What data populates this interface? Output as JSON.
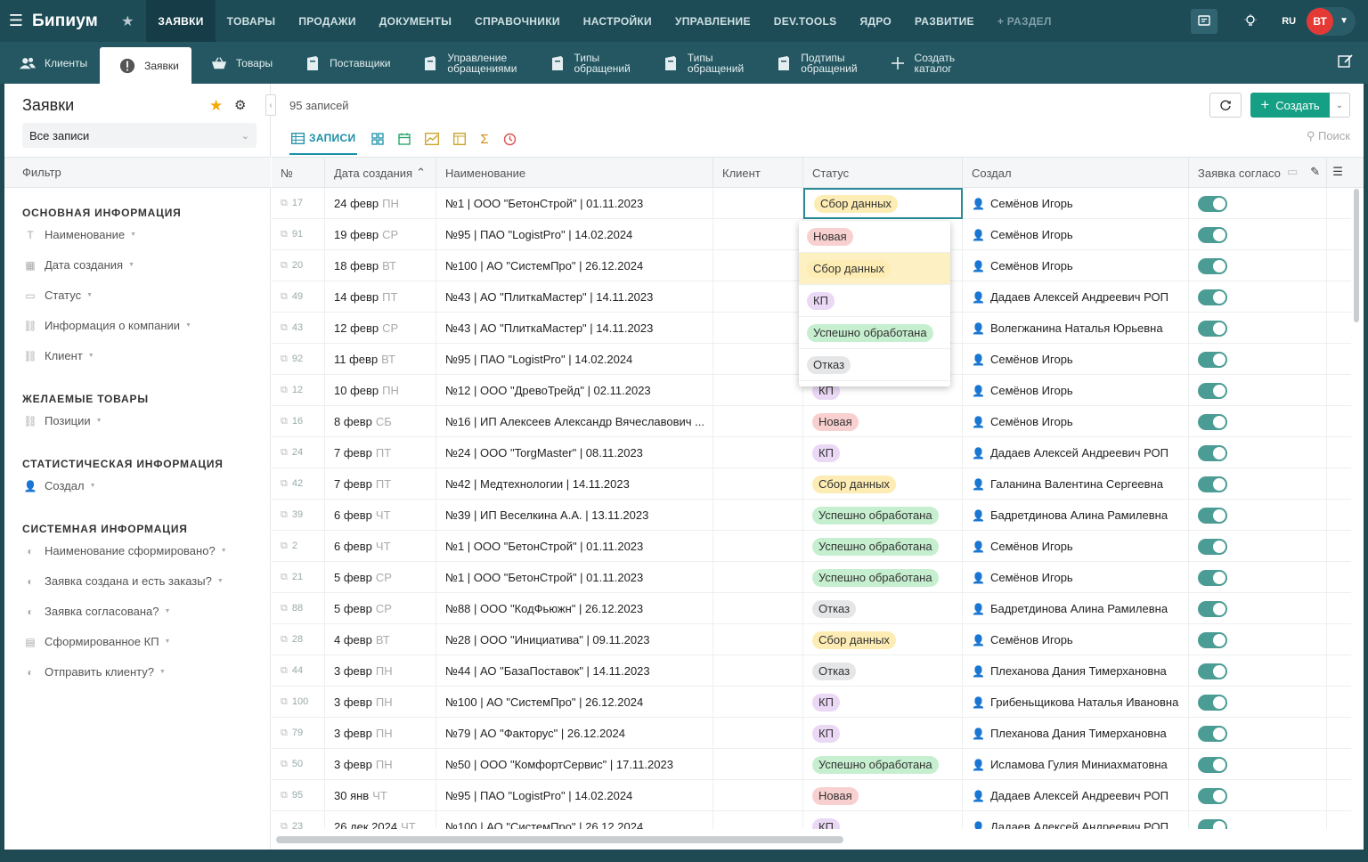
{
  "app": {
    "logo": "Бипиум",
    "lang": "RU",
    "avatar_initials": "ВТ"
  },
  "topnav": [
    "ЗАЯВКИ",
    "ТОВАРЫ",
    "ПРОДАЖИ",
    "ДОКУМЕНТЫ",
    "СПРАВОЧНИКИ",
    "НАСТРОЙКИ",
    "УПРАВЛЕНИЕ",
    "DEV.TOOLS",
    "ЯДРО",
    "РАЗВИТИЕ",
    "+ РАЗДЕЛ"
  ],
  "subtabs": [
    {
      "l1": "Клиенты",
      "l2": ""
    },
    {
      "l1": "Заявки",
      "l2": ""
    },
    {
      "l1": "Товары",
      "l2": ""
    },
    {
      "l1": "Поставщики",
      "l2": ""
    },
    {
      "l1": "Управление",
      "l2": "обращениями"
    },
    {
      "l1": "Типы",
      "l2": "обращений"
    },
    {
      "l1": "Типы",
      "l2": "обращений"
    },
    {
      "l1": "Подтипы",
      "l2": "обращений"
    },
    {
      "l1": "Создать",
      "l2": "каталог"
    }
  ],
  "left": {
    "title": "Заявки",
    "view": "Все записи",
    "filter_label": "Фильтр",
    "groups": [
      {
        "title": "ОСНОВНАЯ ИНФОРМАЦИЯ",
        "items": [
          "Наименование",
          "Дата создания",
          "Статус",
          "Информация о компании",
          "Клиент"
        ]
      },
      {
        "title": "ЖЕЛАЕМЫЕ ТОВАРЫ",
        "items": [
          "Позиции"
        ]
      },
      {
        "title": "СТАТИСТИЧЕСКАЯ ИНФОРМАЦИЯ",
        "items": [
          "Создал"
        ]
      },
      {
        "title": "СИСТЕМНАЯ ИНФОРМАЦИЯ",
        "items": [
          "Наименование сформировано?",
          "Заявка создана и есть заказы?",
          "Заявка согласована?",
          "Сформированное КП",
          "Отправить клиенту?"
        ]
      }
    ]
  },
  "toolbar": {
    "count": "95 записей",
    "create": "Создать",
    "records_tab": "ЗАПИСИ",
    "search": "Поиск"
  },
  "columns": [
    "№",
    "Дата создания",
    "Наименование",
    "Клиент",
    "Статус",
    "Создал",
    "Заявка согласо"
  ],
  "rows": [
    {
      "n": "17",
      "d": "24 февр",
      "w": "ПН",
      "name": "№1 | ООО \"БетонСтрой\" | 01.11.2023",
      "s": "Сбор данных",
      "by": "Семёнов Игорь"
    },
    {
      "n": "91",
      "d": "19 февр",
      "w": "СР",
      "name": "№95 | ПАО \"LogistPro\" | 14.02.2024",
      "s": "",
      "by": "Семёнов Игорь"
    },
    {
      "n": "20",
      "d": "18 февр",
      "w": "ВТ",
      "name": "№100 | АО \"СистемПро\" | 26.12.2024",
      "s": "",
      "by": "Семёнов Игорь"
    },
    {
      "n": "49",
      "d": "14 февр",
      "w": "ПТ",
      "name": "№43 | АО \"ПлиткаМастер\" | 14.11.2023",
      "s": "",
      "by": "Дадаев Алексей Андреевич РОП"
    },
    {
      "n": "43",
      "d": "12 февр",
      "w": "СР",
      "name": "№43 | АО \"ПлиткаМастер\" | 14.11.2023",
      "s": "",
      "by": "Волегжанина Наталья Юрьевна"
    },
    {
      "n": "92",
      "d": "11 февр",
      "w": "ВТ",
      "name": "№95 | ПАО \"LogistPro\" | 14.02.2024",
      "s": "",
      "by": "Семёнов Игорь"
    },
    {
      "n": "12",
      "d": "10 февр",
      "w": "ПН",
      "name": "№12 | ООО \"ДревоТрейд\" | 02.11.2023",
      "s": "КП",
      "by": "Семёнов Игорь"
    },
    {
      "n": "16",
      "d": "8 февр",
      "w": "СБ",
      "name": "№16 | ИП Алексеев Александр Вячеславович ...",
      "s": "Новая",
      "by": "Семёнов Игорь"
    },
    {
      "n": "24",
      "d": "7 февр",
      "w": "ПТ",
      "name": "№24 | ООО \"TorgMaster\" | 08.11.2023",
      "s": "КП",
      "by": "Дадаев Алексей Андреевич РОП"
    },
    {
      "n": "42",
      "d": "7 февр",
      "w": "ПТ",
      "name": "№42 | Медтехнологии | 14.11.2023",
      "s": "Сбор данных",
      "by": "Галанина Валентина Сергеевна"
    },
    {
      "n": "39",
      "d": "6 февр",
      "w": "ЧТ",
      "name": "№39 | ИП Веселкина А.А. | 13.11.2023",
      "s": "Успешно обработана",
      "by": "Бадретдинова Алина Рамилевна"
    },
    {
      "n": "2",
      "d": "6 февр",
      "w": "ЧТ",
      "name": "№1 | ООО \"БетонСтрой\" | 01.11.2023",
      "s": "Успешно обработана",
      "by": "Семёнов Игорь"
    },
    {
      "n": "21",
      "d": "5 февр",
      "w": "СР",
      "name": "№1 | ООО \"БетонСтрой\" | 01.11.2023",
      "s": "Успешно обработана",
      "by": "Семёнов Игорь"
    },
    {
      "n": "88",
      "d": "5 февр",
      "w": "СР",
      "name": "№88 | ООО \"КодФьюжн\" | 26.12.2023",
      "s": "Отказ",
      "by": "Бадретдинова Алина Рамилевна"
    },
    {
      "n": "28",
      "d": "4 февр",
      "w": "ВТ",
      "name": "№28 | ООО \"Инициатива\" | 09.11.2023",
      "s": "Сбор данных",
      "by": "Семёнов Игорь"
    },
    {
      "n": "44",
      "d": "3 февр",
      "w": "ПН",
      "name": "№44 | АО \"БазаПоставок\" | 14.11.2023",
      "s": "Отказ",
      "by": "Плеханова Дания Тимерхановна"
    },
    {
      "n": "100",
      "d": "3 февр",
      "w": "ПН",
      "name": "№100 | АО \"СистемПро\" | 26.12.2024",
      "s": "КП",
      "by": "Грибеньщикова Наталья Ивановна"
    },
    {
      "n": "79",
      "d": "3 февр",
      "w": "ПН",
      "name": "№79 | АО \"Факторус\" | 26.12.2024",
      "s": "КП",
      "by": "Плеханова Дания Тимерхановна"
    },
    {
      "n": "50",
      "d": "3 февр",
      "w": "ПН",
      "name": "№50 | ООО \"КомфортСервис\" | 17.11.2023",
      "s": "Успешно обработана",
      "by": "Исламова Гулия Миниахматовна"
    },
    {
      "n": "95",
      "d": "30 янв",
      "w": "ЧТ",
      "name": "№95 | ПАО \"LogistPro\" | 14.02.2024",
      "s": "Новая",
      "by": "Дадаев Алексей Андреевич РОП"
    },
    {
      "n": "23",
      "d": "26 дек 2024",
      "w": "ЧТ",
      "name": "№100 | АО \"СистемПро\" | 26.12.2024",
      "s": "КП",
      "by": "Дадаев Алексей Андреевич РОП"
    }
  ],
  "dropdown": [
    "Новая",
    "Сбор данных",
    "КП",
    "Успешно обработана",
    "Отказ"
  ],
  "status_classes": {
    "Новая": "b-new",
    "Сбор данных": "b-sbor",
    "КП": "b-kp",
    "Успешно обработана": "b-ok",
    "Отказ": "b-otk"
  },
  "colors": {
    "topbar": "#1d4c57",
    "accent": "#15a085",
    "toggle": "#4a9c94"
  }
}
